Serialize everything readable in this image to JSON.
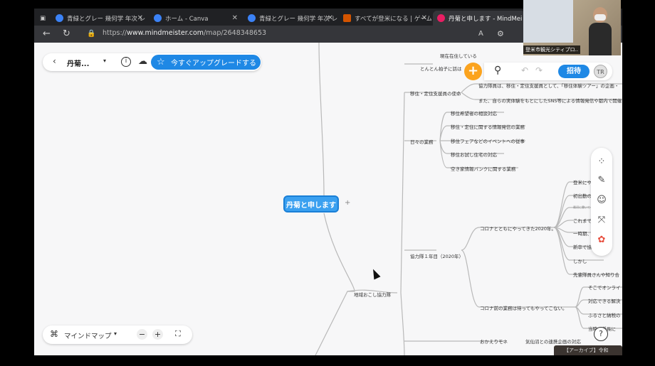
{
  "browser": {
    "tabs": [
      {
        "title": "青緑とグレー 幾何学 年次 レ",
        "color": "#3b82f6"
      },
      {
        "title": "ホーム - Canva",
        "color": "#3b82f6"
      },
      {
        "title": "青緑とグレー 幾何学 年次 レ",
        "color": "#3b82f6"
      },
      {
        "title": "すべてが登米になる | ゲーム",
        "color": "#d35400"
      },
      {
        "title": "丹菊と申します - MindMei",
        "color": "#e91e63"
      }
    ],
    "url_prefix": "https://",
    "url_domain": "www.mindmeister.com",
    "url_path": "/map/2648348653"
  },
  "toolbar": {
    "map_title": "丹菊...",
    "upgrade_label": "今すぐアップグレードする",
    "invite_label": "招待",
    "avatar_initials": "TR"
  },
  "bottom": {
    "view_label": "マインドマップ",
    "zoom_out": "−",
    "zoom_in": "+"
  },
  "mindmap": {
    "root": "丹菊と申します",
    "root_plus": "+",
    "branches": {
      "top_partial": "現在在住している",
      "tonton": "とんとん拍子に話は",
      "mission": "移住・定住支援員の使命",
      "mission_1": "協力隊員は、移住・定住支援員として、「移住体験ツアー」の企画・",
      "mission_2": "また、自らの実体験をもとにしたSNS等による情報発信や都内で開催",
      "daily": "日々の業務",
      "daily_1": "移住希望者の相談対応",
      "daily_2": "移住・定住に関する情報発信の業務",
      "daily_3": "移住フェアなどのイベントへの従事",
      "daily_4": "移住お試し住宅の対応",
      "daily_5": "空き家情報バンクに関する業務",
      "year1": "協力隊１年目（2020年）",
      "corona": "コロナとともにやってきた2020年。",
      "c1": "登米にや",
      "c2": "初出勤の",
      "c3": "最初に書いて",
      "c4": "これまで",
      "c5": "一時期、",
      "c6": "新卒で協",
      "c7": "しかし",
      "c8": "先輩隊員さんや知り合",
      "prework": "コロナ前の業務は待ってもやってこない。",
      "p1": "そこでオンライ",
      "p2": "対応できる解決",
      "p3": "ふるさと納税の",
      "p4": "当時の係長に",
      "chiiki": "地域おこし協力隊",
      "okaeri": "おかえりモネ",
      "kesennuma": "気仙沼との連携企画の対応"
    }
  },
  "webcam": {
    "caption": "登米市観光シティプロ.."
  },
  "archive_label": "【アーカイブ】令和"
}
